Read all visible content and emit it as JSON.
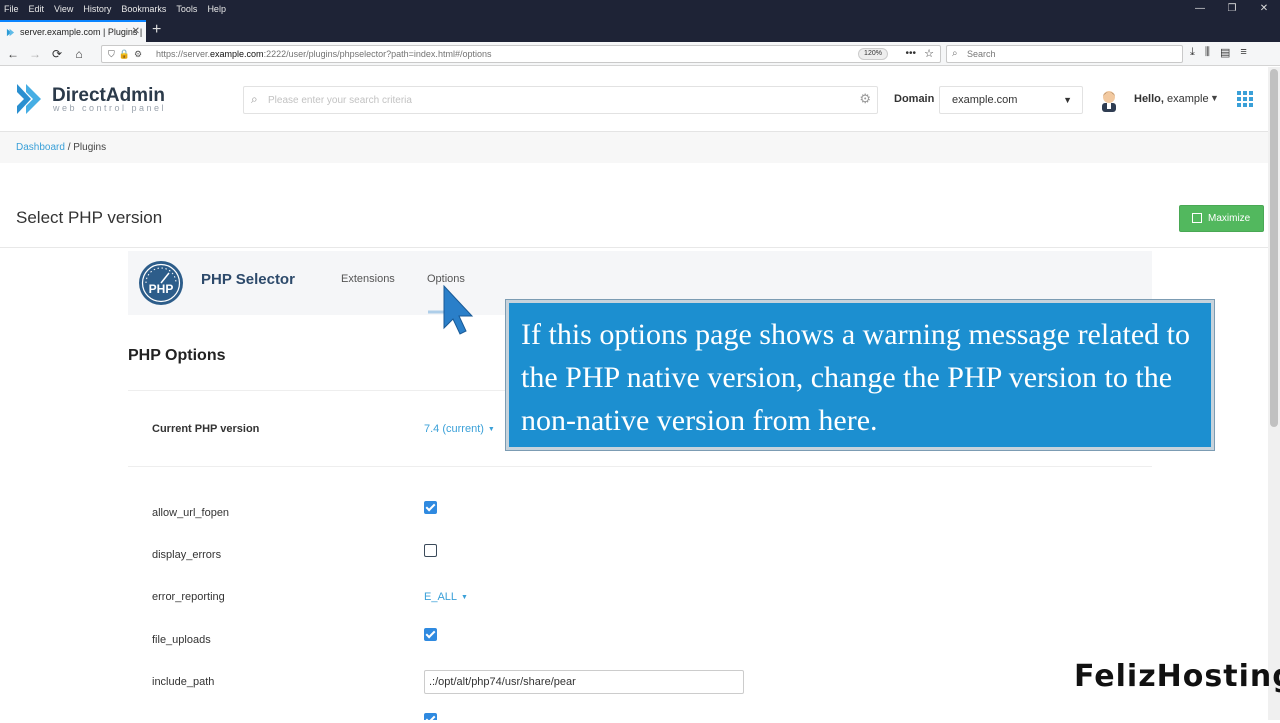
{
  "browser": {
    "menu": [
      "File",
      "Edit",
      "View",
      "History",
      "Bookmarks",
      "Tools",
      "Help"
    ],
    "window_controls": [
      "—",
      "❐",
      "✕"
    ],
    "tab_title": "server.example.com | Plugins |",
    "url_prefix": "https://server.",
    "url_host": "example.com",
    "url_rest": ":2222/user/plugins/phpselector?path=index.html#/options",
    "zoom": "120%",
    "search_placeholder": "Search"
  },
  "header": {
    "logo_text": "DirectAdmin",
    "logo_sub": "web control panel",
    "search_placeholder": "Please enter your search criteria",
    "domain_label": "Domain",
    "domain_value": "example.com",
    "hello_prefix": "Hello,",
    "user": "example"
  },
  "breadcrumb": {
    "dashboard": "Dashboard",
    "sep": " / ",
    "current": "Plugins"
  },
  "page": {
    "title": "Select PHP version",
    "maximize_label": "Maximize"
  },
  "plugin": {
    "logo_text": "PHP",
    "name": "PHP Selector",
    "tabs": [
      "Extensions",
      "Options"
    ]
  },
  "options": {
    "section_title": "PHP Options",
    "current_label": "Current PHP version",
    "current_value": "7.4 (current)",
    "rows": [
      {
        "name": "allow_url_fopen",
        "checked": true
      },
      {
        "name": "display_errors",
        "checked": false
      },
      {
        "name": "error_reporting",
        "value": "E_ALL"
      },
      {
        "name": "file_uploads",
        "checked": true
      },
      {
        "name": "include_path",
        "value": ".:/opt/alt/php74/usr/share/pear"
      }
    ]
  },
  "overlay": {
    "callout_text": "If this options page shows a warning message related to the PHP native version, change the PHP version to the non-native version from here.",
    "watermark": "FelizHosting"
  },
  "colors": {
    "accent": "#3aa0d8",
    "maximize": "#52b85e",
    "callout": "#1c8fd0",
    "checkbox": "#2f8ae0"
  }
}
